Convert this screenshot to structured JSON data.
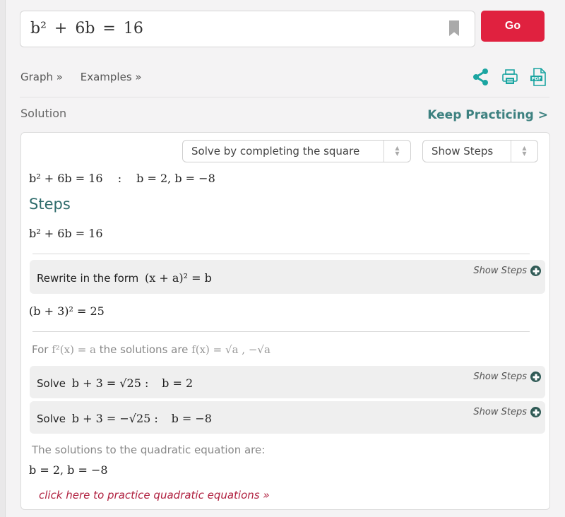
{
  "search": {
    "query": "b² + 6b = 16",
    "go_label": "Go"
  },
  "links": {
    "graph": "Graph »",
    "examples": "Examples »"
  },
  "toolbar": {
    "icons": [
      "share-icon",
      "print-icon",
      "pdf-icon"
    ],
    "accent": "#1ba5a1"
  },
  "solution": {
    "label": "Solution",
    "keep_practicing": "Keep Practicing >",
    "method_select": "Solve by completing the square",
    "steps_select": "Show Steps",
    "result_eq": "b² + 6b = 16",
    "result_sep": ":",
    "result_value": "b = 2, b = −8"
  },
  "steps": {
    "heading": "Steps",
    "initial_eq": "b² + 6b = 16",
    "step1": {
      "text": "Rewrite in the form",
      "math": "(x + a)² = b",
      "show_steps": "Show Steps"
    },
    "step1_result": "(b + 3)² = 25",
    "rule": {
      "prefix": "For",
      "condition": "f²(x) = a",
      "middle": "the solutions are",
      "solutions": "f(x) = √a , −√a"
    },
    "step2": {
      "text": "Solve",
      "math": "b + 3 = √25 :",
      "result": "b = 2",
      "show_steps": "Show Steps"
    },
    "step3": {
      "text": "Solve",
      "math": "b + 3 = −√25 :",
      "result": "b = −8",
      "show_steps": "Show Steps"
    },
    "solutions_label": "The solutions to the quadratic equation are:",
    "solutions_eq": "b = 2, b = −8",
    "practice_link": "click here to practice quadratic equations »"
  },
  "colors": {
    "go_button": "#e0213f",
    "keep_practicing": "#3d8180",
    "steps_heading": "#2e6b6b",
    "practice_link": "#b0203f"
  }
}
